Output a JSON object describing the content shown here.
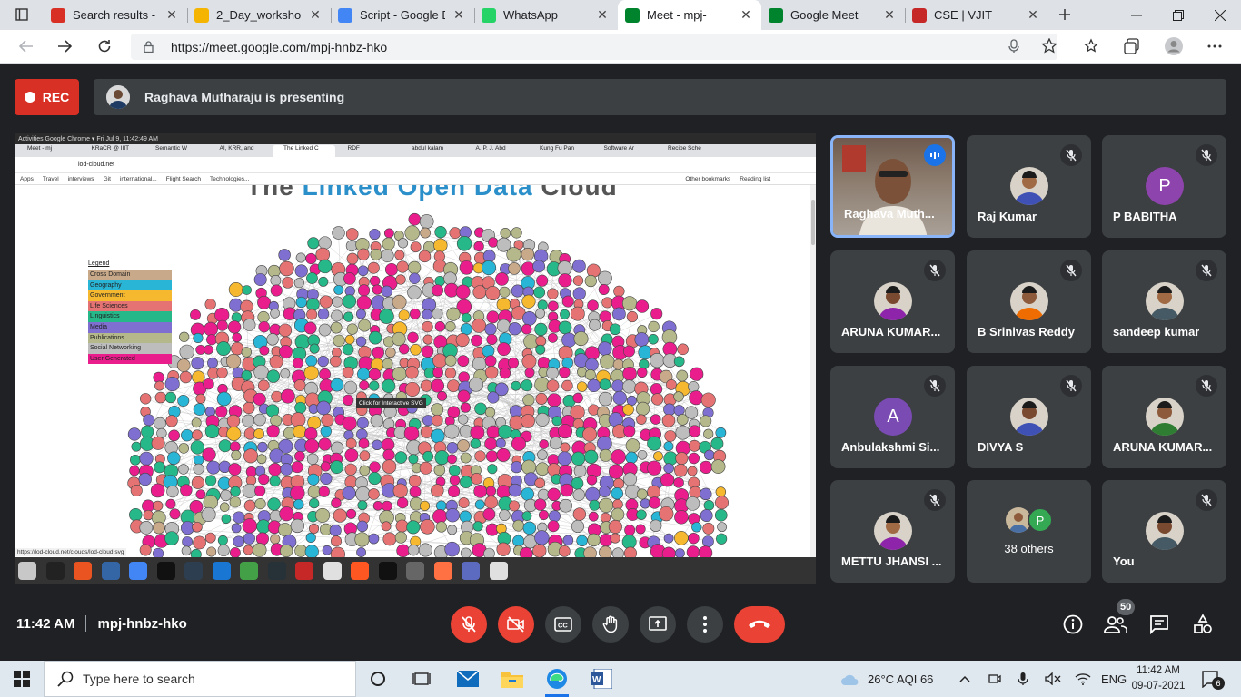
{
  "browser": {
    "tabs": [
      {
        "title": "Search results - c",
        "favicon": "gmail-icon",
        "color": "#d93025"
      },
      {
        "title": "2_Day_workshop_",
        "favicon": "drive-icon",
        "color": "#f4b400"
      },
      {
        "title": "Script - Google D",
        "favicon": "docs-icon",
        "color": "#4285f4"
      },
      {
        "title": "WhatsApp",
        "favicon": "whatsapp-icon",
        "color": "#25d366"
      },
      {
        "title": "Meet - mpj-",
        "favicon": "meet-icon",
        "color": "#00832d"
      },
      {
        "title": "Google Meet",
        "favicon": "meet-icon",
        "color": "#00832d"
      },
      {
        "title": "CSE | VJIT",
        "favicon": "vjit-icon",
        "color": "#c62828"
      }
    ],
    "url": "https://meet.google.com/mpj-hnbz-hko"
  },
  "meet": {
    "rec_label": "REC",
    "presenting_text": "Raghava Mutharaju is presenting",
    "meeting_time": "11:42 AM",
    "meeting_code": "mpj-hnbz-hko",
    "participant_count": "50",
    "participants": [
      {
        "name": "Raghava Muth...",
        "avatar": "video",
        "speaking": true
      },
      {
        "name": "Raj Kumar",
        "avatar": "photo",
        "muted": true
      },
      {
        "name": "P BABITHA",
        "avatar": "letter",
        "letter": "P",
        "color": "#8e44ad",
        "muted": true
      },
      {
        "name": "ARUNA KUMAR...",
        "avatar": "photo",
        "muted": true
      },
      {
        "name": "B Srinivas Reddy",
        "avatar": "photo",
        "muted": true
      },
      {
        "name": "sandeep kumar",
        "avatar": "photo",
        "muted": true
      },
      {
        "name": "Anbulakshmi Si...",
        "avatar": "letter",
        "letter": "A",
        "color": "#7b4bb4",
        "muted": true
      },
      {
        "name": "DIVYA S",
        "avatar": "photo",
        "muted": true
      },
      {
        "name": "ARUNA KUMAR...",
        "avatar": "photo",
        "muted": true
      },
      {
        "name": "METTU JHANSI ...",
        "avatar": "photo",
        "muted": true
      },
      {
        "name": "38 others",
        "avatar": "group",
        "group_letter": "P"
      },
      {
        "name": "You",
        "avatar": "photo",
        "muted": true
      }
    ]
  },
  "shared_screen": {
    "top_bar": "Activities    Google Chrome ▾                                                                   Fri Jul  9, 11:42:49 AM",
    "tabs": [
      "Meet - mj",
      "KRaCR @ IIIT",
      "Semantic W",
      "AI, KRR, and",
      "The Linked C",
      "RDF",
      "abdul kalam",
      "A. P. J. Abd",
      "Kung Fu Pan",
      "Software Ar",
      "Recipe Sche"
    ],
    "address": "lod-cloud.net",
    "bookmarks": [
      "Apps",
      "Travel",
      "interviews",
      "Git",
      "international...",
      "Flight Search",
      "Technologies...",
      "Other bookmarks",
      "Reading list"
    ],
    "title_part1": "The ",
    "title_part2": "Linked Open Data",
    "title_part3": " Cloud",
    "legend_heading": "Legend",
    "legend": [
      {
        "label": "Cross Domain",
        "color": "#c8a98a"
      },
      {
        "label": "Geography",
        "color": "#29b6d6"
      },
      {
        "label": "Government",
        "color": "#f5b82e"
      },
      {
        "label": "Life Sciences",
        "color": "#e57373"
      },
      {
        "label": "Linguistics",
        "color": "#26b889"
      },
      {
        "label": "Media",
        "color": "#7e6fd1"
      },
      {
        "label": "Publications",
        "color": "#b5b88a"
      },
      {
        "label": "Social Networking",
        "color": "#bdbdbd"
      },
      {
        "label": "User Generated",
        "color": "#e91e8c"
      }
    ],
    "tooltip": "Click for Interactive SVG",
    "status_url": "https://lod-cloud.net/clouds/lod-cloud.svg"
  },
  "taskbar": {
    "search_placeholder": "Type here to search",
    "weather": "26°C  AQI 66",
    "language": "ENG",
    "time": "11:42 AM",
    "date": "09-07-2021",
    "notifications": "6"
  }
}
